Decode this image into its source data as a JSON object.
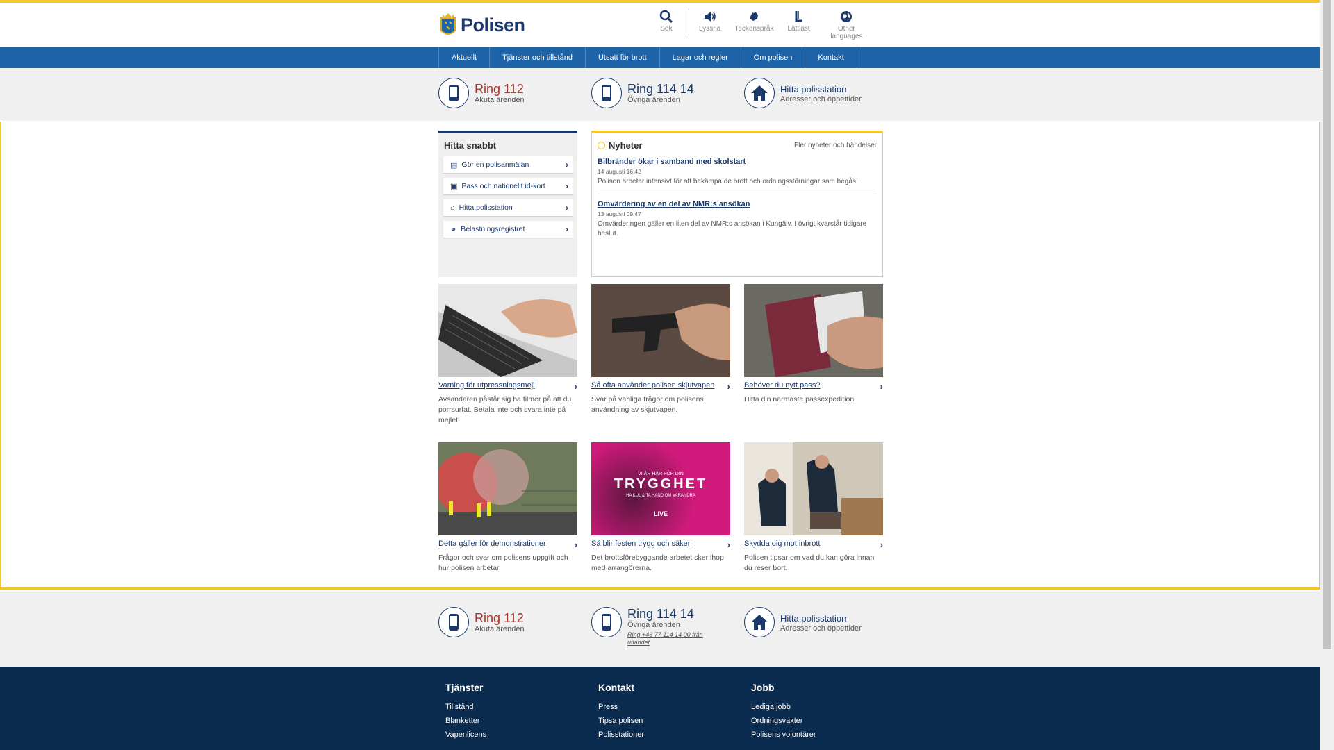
{
  "header": {
    "logo_text": "Polisen",
    "tools": [
      {
        "label": "Sök",
        "icon": "search-icon"
      },
      {
        "label": "Lyssna",
        "icon": "speaker-icon"
      },
      {
        "label": "Teckenspråk",
        "icon": "hand-icon"
      },
      {
        "label": "Lättläst",
        "icon": "lattlast-icon"
      },
      {
        "label": "Other languages",
        "icon": "globe-icon"
      }
    ]
  },
  "nav": [
    "Aktuellt",
    "Tjänster och tillstånd",
    "Utsatt för brott",
    "Lagar och regler",
    "Om polisen",
    "Kontakt"
  ],
  "call": {
    "ring112": {
      "title": "Ring 112",
      "sub": "Akuta ärenden"
    },
    "ring11414": {
      "title": "Ring 114 14",
      "sub": "Övriga ärenden"
    },
    "station": {
      "title": "Hitta polisstation",
      "sub": "Adresser och öppettider"
    },
    "abroad": "Ring +46 77 114 14 00 från utlandet"
  },
  "quick": {
    "title": "Hitta snabbt",
    "items": [
      "Gör en polisanmälan",
      "Pass och nationellt id-kort",
      "Hitta polisstation",
      "Belastningsregistret"
    ]
  },
  "news": {
    "title": "Nyheter",
    "more": "Fler nyheter och händelser",
    "articles": [
      {
        "title": "Bilbränder ökar i samband med skolstart",
        "date": "14 augusti 16.42",
        "text": "Polisen arbetar intensivt för att bekämpa de brott och ordningsstörningar som begås."
      },
      {
        "title": "Omvärdering av en del av NMR:s ansökan",
        "date": "13 augusti 09.47",
        "text": "Omvärderingen gäller en liten del av NMR:s ansökan i Kungälv. I övrigt kvarstår tidigare beslut."
      }
    ]
  },
  "cards": [
    {
      "title": "Varning för utpressningsmejl",
      "desc": "Avsändaren påstår sig ha filmer på att du porrsurfat. Betala inte och svara inte på mejlet."
    },
    {
      "title": "Så ofta använder polisen skjutvapen",
      "desc": "Svar på vanliga frågor om polisens användning av skjutvapen."
    },
    {
      "title": "Behöver du nytt pass?",
      "desc": "Hitta din närmaste passexpedition."
    },
    {
      "title": "Detta gäller för demonstrationer",
      "desc": "Frågor och svar om polisens uppgift och hur polisen arbetar."
    },
    {
      "title": "Så blir festen trygg och säker",
      "desc": "Det brottsförebyggande arbetet sker ihop med arrangörerna."
    },
    {
      "title": "Skydda dig mot inbrott",
      "desc": "Polisen tipsar om vad du kan göra innan du reser bort."
    }
  ],
  "poster": {
    "line1": "VI ÄR HÄR FÖR DIN",
    "line2": "TRYGGHET",
    "line3": "HA KUL & TA HAND OM VARANDRA",
    "line4": "LIVE"
  },
  "footer": {
    "cols": [
      {
        "title": "Tjänster",
        "items": [
          "Tillstånd",
          "Blanketter",
          "Vapenlicens"
        ]
      },
      {
        "title": "Kontakt",
        "items": [
          "Press",
          "Tipsa polisen",
          "Polisstationer"
        ]
      },
      {
        "title": "Jobb",
        "items": [
          "Lediga jobb",
          "Ordningsvakter",
          "Polisens volontärer"
        ]
      }
    ]
  },
  "colors": {
    "brand_blue": "#1c63a8",
    "dark_blue": "#1b3a6b",
    "accent_yellow": "#f4c62b",
    "footer": "#0b2c4f",
    "red": "#b3302a"
  }
}
